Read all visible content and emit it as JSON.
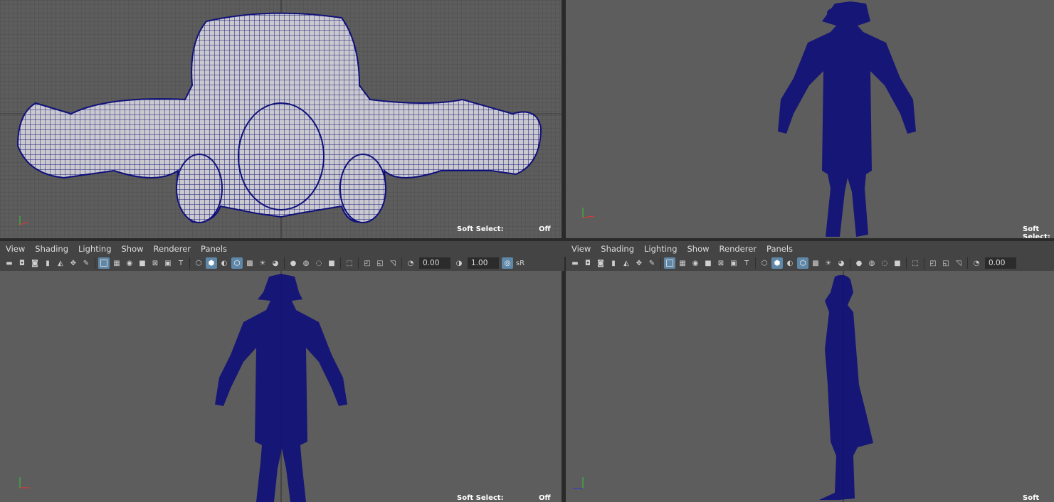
{
  "menu": {
    "items": [
      "View",
      "Shading",
      "Lighting",
      "Show",
      "Renderer",
      "Panels"
    ]
  },
  "toolbar": {
    "exposure": "0.00",
    "gamma": "1.00",
    "cm_label": "sR"
  },
  "soft_select": {
    "label": "Soft Select:",
    "value": "Off"
  },
  "panels": {
    "top": {
      "name": "top viewport"
    },
    "persp": {
      "name": "perspective viewport"
    },
    "front": {
      "name": "front viewport"
    },
    "side": {
      "name": "side viewport"
    }
  },
  "colors": {
    "wire": "#10107a",
    "viewport_bg": "#5d5d5d",
    "grid": "#4a4a4a",
    "toolbar_bg": "#444444",
    "active_btn": "#5f87a8"
  }
}
